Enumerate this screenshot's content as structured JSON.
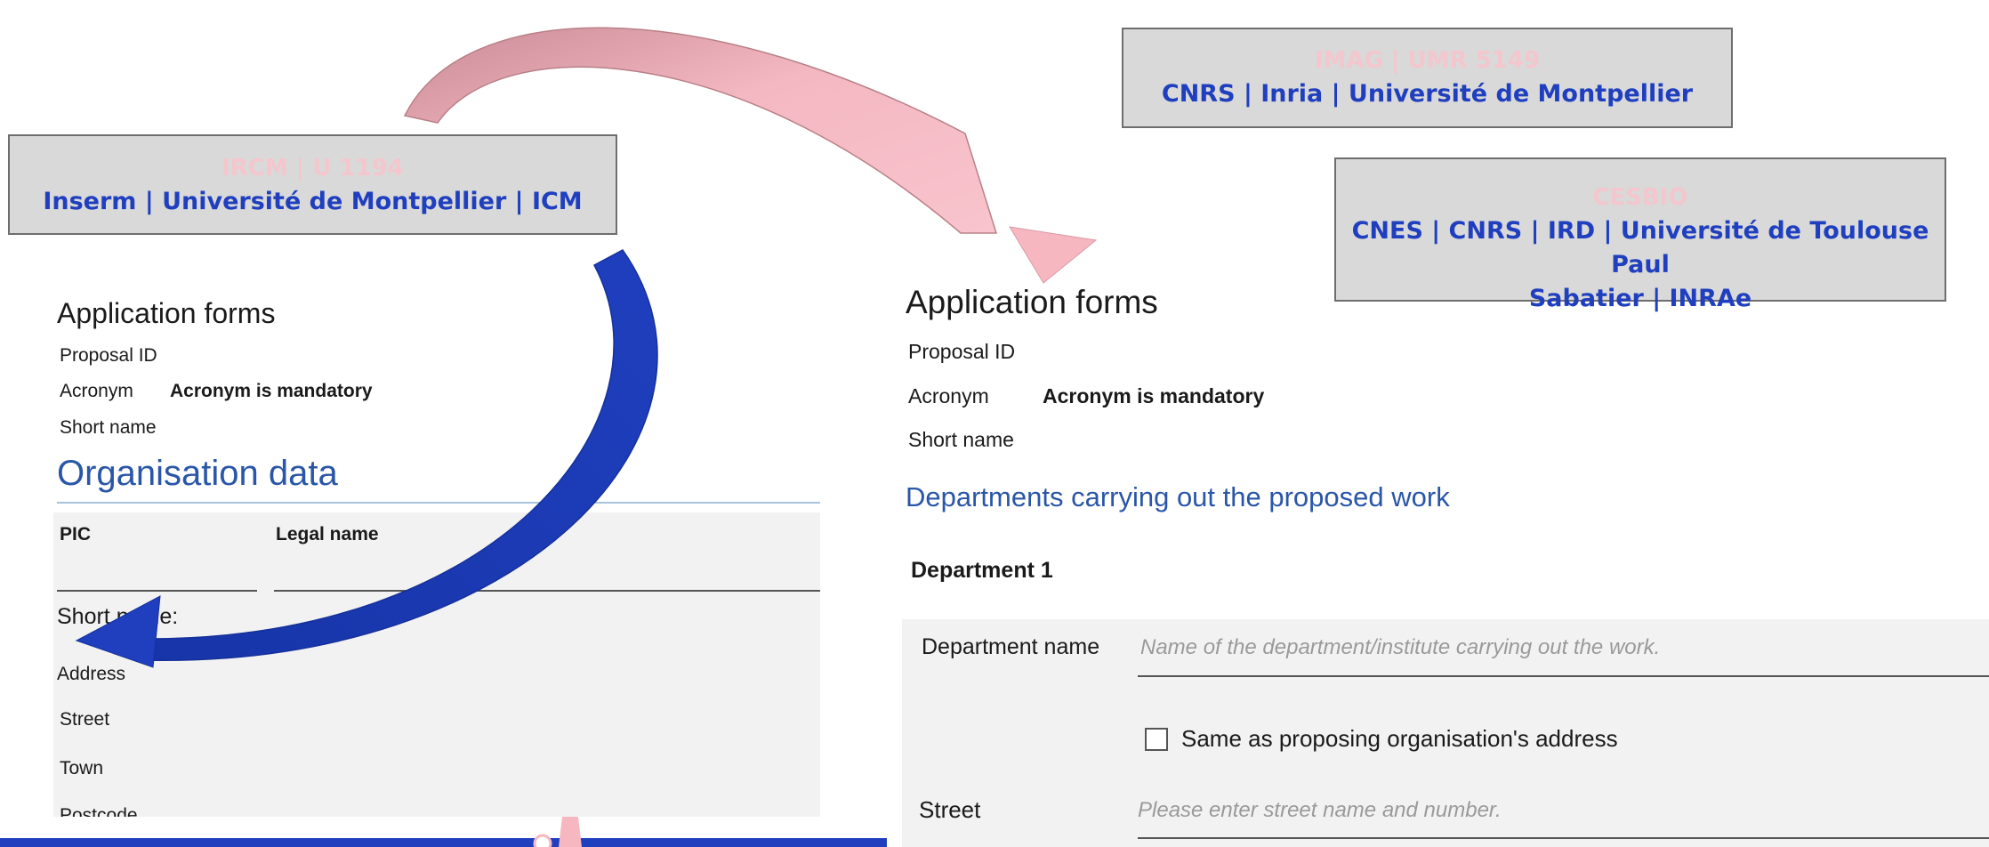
{
  "lab_boxes": {
    "imag": {
      "name": "IMAG | UMR 5149",
      "affiliation": "CNRS | Inria | Université de Montpellier"
    },
    "ircm": {
      "name": "IRCM | U 1194",
      "affiliation": "Inserm | Université de Montpellier | ICM"
    },
    "cesbio": {
      "name": "CESBIO",
      "affiliation_line1": "CNES | CNRS | IRD | Université de Toulouse Paul",
      "affiliation_line2": "Sabatier | INRAe"
    }
  },
  "left_form": {
    "title": "Application forms",
    "proposal_id_label": "Proposal ID",
    "acronym_label": "Acronym",
    "acronym_value": "Acronym is mandatory",
    "short_name_label": "Short name",
    "section_title": "Organisation data",
    "pic_label": "PIC",
    "legal_name_label": "Legal name",
    "short_name_field_label": "Short name:",
    "address_label": "Address",
    "street_label": "Street",
    "town_label": "Town",
    "postcode_label": "Postcode"
  },
  "right_form": {
    "title": "Application forms",
    "proposal_id_label": "Proposal ID",
    "acronym_label": "Acronym",
    "acronym_value": "Acronym is mandatory",
    "short_name_label": "Short name",
    "section_title": "Departments carrying out the proposed work",
    "department_heading": "Department 1",
    "department_name_label": "Department name",
    "department_name_placeholder": "Name of the department/institute carrying out the work.",
    "same_address_label": "Same as proposing organisation's address",
    "street_label": "Street",
    "street_placeholder": "Please enter street name and number."
  },
  "colors": {
    "arrow_pink": "#f6b7c1",
    "arrow_pink_dark": "#c98b95",
    "arrow_blue": "#1f3fbf",
    "section_blue": "#2a56a8"
  }
}
